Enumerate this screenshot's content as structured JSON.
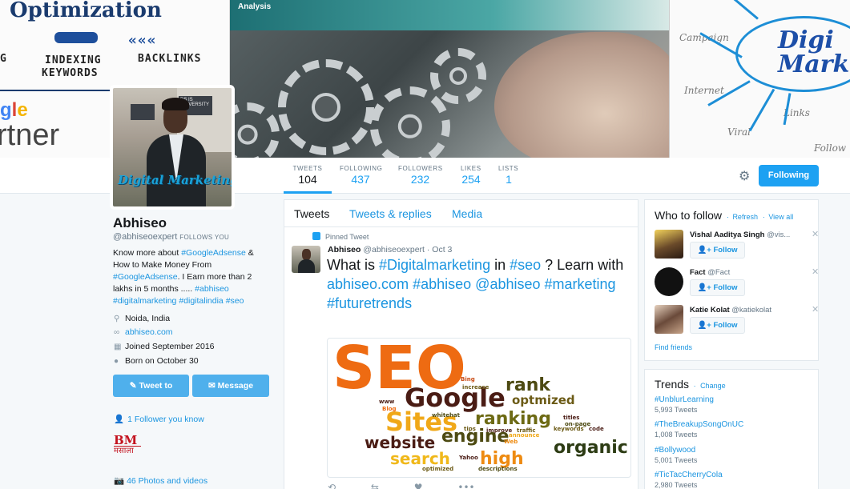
{
  "banner": {
    "left_title": "Optimization",
    "left_kw1": "G",
    "left_kw2a": "INDEXING",
    "left_kw2b": "KEYWORDS",
    "left_kw3": "BACKLINKS",
    "left_google": "gle",
    "left_partner": "rtner",
    "mid_label": "Analysis",
    "right_words": [
      "Campaign",
      "Internet",
      "Links",
      "Viral",
      "Follow"
    ],
    "right_title_1": "Digi",
    "right_title_2": "Marke"
  },
  "profile": {
    "avatar_text": "Digital Marketing",
    "avatar_sign": "DS IS UNIVERSITY",
    "name": "Abhiseo",
    "handle": "@abhiseoexpert",
    "follows_you": "FOLLOWS YOU",
    "bio": [
      {
        "t": "Know more about ",
        "link": false
      },
      {
        "t": "#GoogleAdsense",
        "link": true
      },
      {
        "t": " & How to Make Money From ",
        "link": false
      },
      {
        "t": "#GoogleAdsense",
        "link": true
      },
      {
        "t": ". I Earn more than 2 lakhs in 5 months ..... ",
        "link": false
      },
      {
        "t": "#abhiseo",
        "link": true
      },
      {
        "t": " ",
        "link": false
      },
      {
        "t": "#digitalmarketing",
        "link": true
      },
      {
        "t": " ",
        "link": false
      },
      {
        "t": "#digitalindia",
        "link": true
      },
      {
        "t": " ",
        "link": false
      },
      {
        "t": "#seo",
        "link": true
      }
    ],
    "location": "Noida, India",
    "website": "abhiseo.com",
    "joined": "Joined September 2016",
    "born": "Born on October 30",
    "tweet_to_label": "Tweet to",
    "message_label": "Message",
    "followers_you_know": "1 Follower you know",
    "bm_line1": "BM",
    "bm_line2": "मसाला",
    "photos": "46 Photos and videos"
  },
  "stats": [
    {
      "label": "Tweets",
      "value": "104"
    },
    {
      "label": "Following",
      "value": "437"
    },
    {
      "label": "Followers",
      "value": "232"
    },
    {
      "label": "Likes",
      "value": "254"
    },
    {
      "label": "Lists",
      "value": "1"
    }
  ],
  "follow_button": "Following",
  "timeline": {
    "tabs": [
      "Tweets",
      "Tweets & replies",
      "Media"
    ],
    "pinned_label": "Pinned Tweet",
    "tweet": {
      "name": "Abhiseo",
      "handle": "@abhiseoexpert",
      "date": "· Oct 3",
      "text": [
        {
          "t": "What is ",
          "link": false
        },
        {
          "t": "#Digitalmarketing",
          "link": true
        },
        {
          "t": " in ",
          "link": false
        },
        {
          "t": "#seo",
          "link": true
        },
        {
          "t": " ? Learn with ",
          "link": false
        },
        {
          "t": "abhiseo.com",
          "link": true
        },
        {
          "t": " ",
          "link": false
        },
        {
          "t": "#abhiseo",
          "link": true
        },
        {
          "t": " ",
          "link": false
        },
        {
          "t": "@abhiseo",
          "link": true
        },
        {
          "t": " ",
          "link": false
        },
        {
          "t": "#marketing",
          "link": true
        },
        {
          "t": " ",
          "link": false
        },
        {
          "t": "#futuretrends",
          "link": true
        }
      ]
    },
    "word_cloud": [
      {
        "w": "SEO",
        "c": "#ee6b12"
      },
      {
        "w": "Google",
        "c": "#4a1c14"
      },
      {
        "w": "rank",
        "c": "#4d4a12"
      },
      {
        "w": "optmized",
        "c": "#6b5a15"
      },
      {
        "w": "Sites",
        "c": "#f0a818"
      },
      {
        "w": "ranking",
        "c": "#6d6a14"
      },
      {
        "w": "website",
        "c": "#4a1c14"
      },
      {
        "w": "engine",
        "c": "#4d4a12"
      },
      {
        "w": "organic",
        "c": "#2d3c14"
      },
      {
        "w": "search",
        "c": "#f0b81a"
      },
      {
        "w": "high",
        "c": "#ee8b12"
      },
      {
        "w": "Bing",
        "c": "#c94a12"
      },
      {
        "w": "increase",
        "c": "#6b5a15"
      },
      {
        "w": "www",
        "c": "#4a1c14"
      },
      {
        "w": "Blog",
        "c": "#ee6b12"
      },
      {
        "w": "whitehat",
        "c": "#4d4a12"
      },
      {
        "w": "tips",
        "c": "#6b5a15"
      },
      {
        "w": "improve",
        "c": "#4a1c14"
      },
      {
        "w": "traffic",
        "c": "#6b5a15"
      },
      {
        "w": "titles",
        "c": "#4a1c14"
      },
      {
        "w": "on-page",
        "c": "#4d4a12"
      },
      {
        "w": "keywords",
        "c": "#6b5a15"
      },
      {
        "w": "code",
        "c": "#4a1c14"
      },
      {
        "w": "announce",
        "c": "#f0a818"
      },
      {
        "w": "Web",
        "c": "#ee8b12"
      },
      {
        "w": "Yahoo",
        "c": "#4a1c14"
      },
      {
        "w": "optimized",
        "c": "#6b5a15"
      },
      {
        "w": "descriptions",
        "c": "#4d4a12"
      }
    ],
    "actions": [
      "⟲",
      "⇆",
      "♥",
      "•••"
    ]
  },
  "who_to_follow": {
    "title": "Who to follow",
    "refresh": "Refresh",
    "view_all": "View all",
    "suggestions": [
      {
        "name": "Vishal Aaditya Singh",
        "handle": "@vis...",
        "button": "Follow"
      },
      {
        "name": "Fact",
        "handle": "@Fact",
        "button": "Follow"
      },
      {
        "name": "Katie Kolat",
        "handle": "@katiekolat",
        "button": "Follow"
      }
    ],
    "find_friends": "Find friends"
  },
  "trends": {
    "title": "Trends",
    "change": "Change",
    "items": [
      {
        "name": "#UnblurLearning",
        "count": "5,993 Tweets"
      },
      {
        "name": "#TheBreakupSongOnUC",
        "count": "1,008 Tweets"
      },
      {
        "name": "#Bollywood",
        "count": "5,001 Tweets"
      },
      {
        "name": "#TicTacCherryCola",
        "count": "2,980 Tweets"
      }
    ]
  },
  "colors": {
    "accent": "#1da1f2",
    "link": "#1b95e0"
  }
}
